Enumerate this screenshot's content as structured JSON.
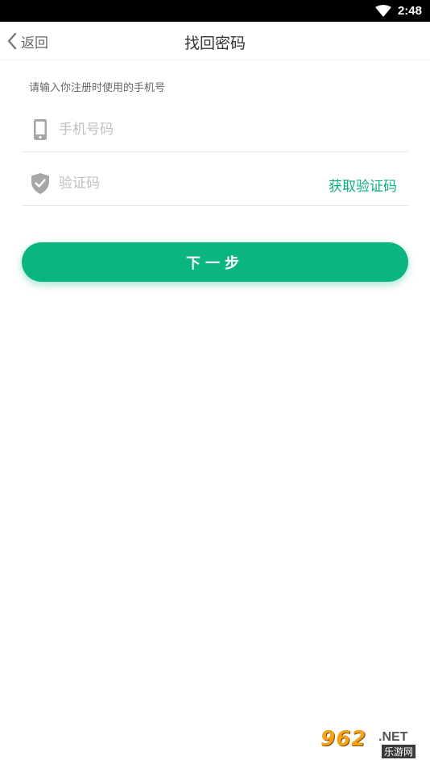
{
  "status_bar": {
    "time": "2:48",
    "icons": [
      "wifi-icon"
    ]
  },
  "header": {
    "back_label": "返回",
    "title": "找回密码",
    "back_icon": "chevron-left-icon"
  },
  "form": {
    "hint": "请输入你注册时使用的手机号",
    "phone": {
      "placeholder": "手机号码",
      "value": "",
      "icon": "phone-icon"
    },
    "code": {
      "placeholder": "验证码",
      "value": "",
      "icon": "shield-check-icon",
      "get_code_label": "获取验证码"
    },
    "next_label": "下一步"
  },
  "watermark": {
    "main": "962",
    "suffix": ".NET",
    "sub": "乐游网"
  },
  "colors": {
    "accent": "#0bb582",
    "link": "#0bb082",
    "title_text": "#333333",
    "hint_text": "#666666",
    "placeholder": "#c0c0c0",
    "icon_gray": "#a6a6a6"
  }
}
